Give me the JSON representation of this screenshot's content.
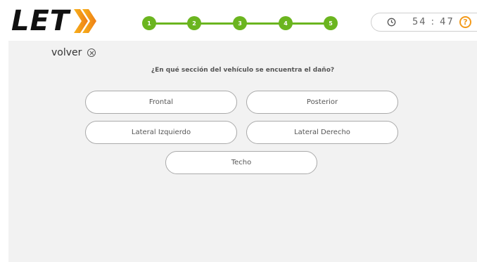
{
  "header": {
    "logo_text": "LET",
    "logo_icon": "double-chevron-right-icon",
    "steps": [
      "1",
      "2",
      "3",
      "4",
      "5"
    ],
    "timer": "54 : 47",
    "timer_icon": "clock-icon",
    "help_icon_glyph": "?",
    "colors": {
      "step_green": "#6bb51f",
      "accent_orange": "#f39a1a"
    }
  },
  "main": {
    "back_label": "volver",
    "back_icon": "close-circle-icon",
    "question": "¿En qué sección del vehículo se encuentra el daño?",
    "options": [
      "Frontal",
      "Posterior",
      "Lateral Izquierdo",
      "Lateral Derecho",
      "Techo"
    ]
  }
}
